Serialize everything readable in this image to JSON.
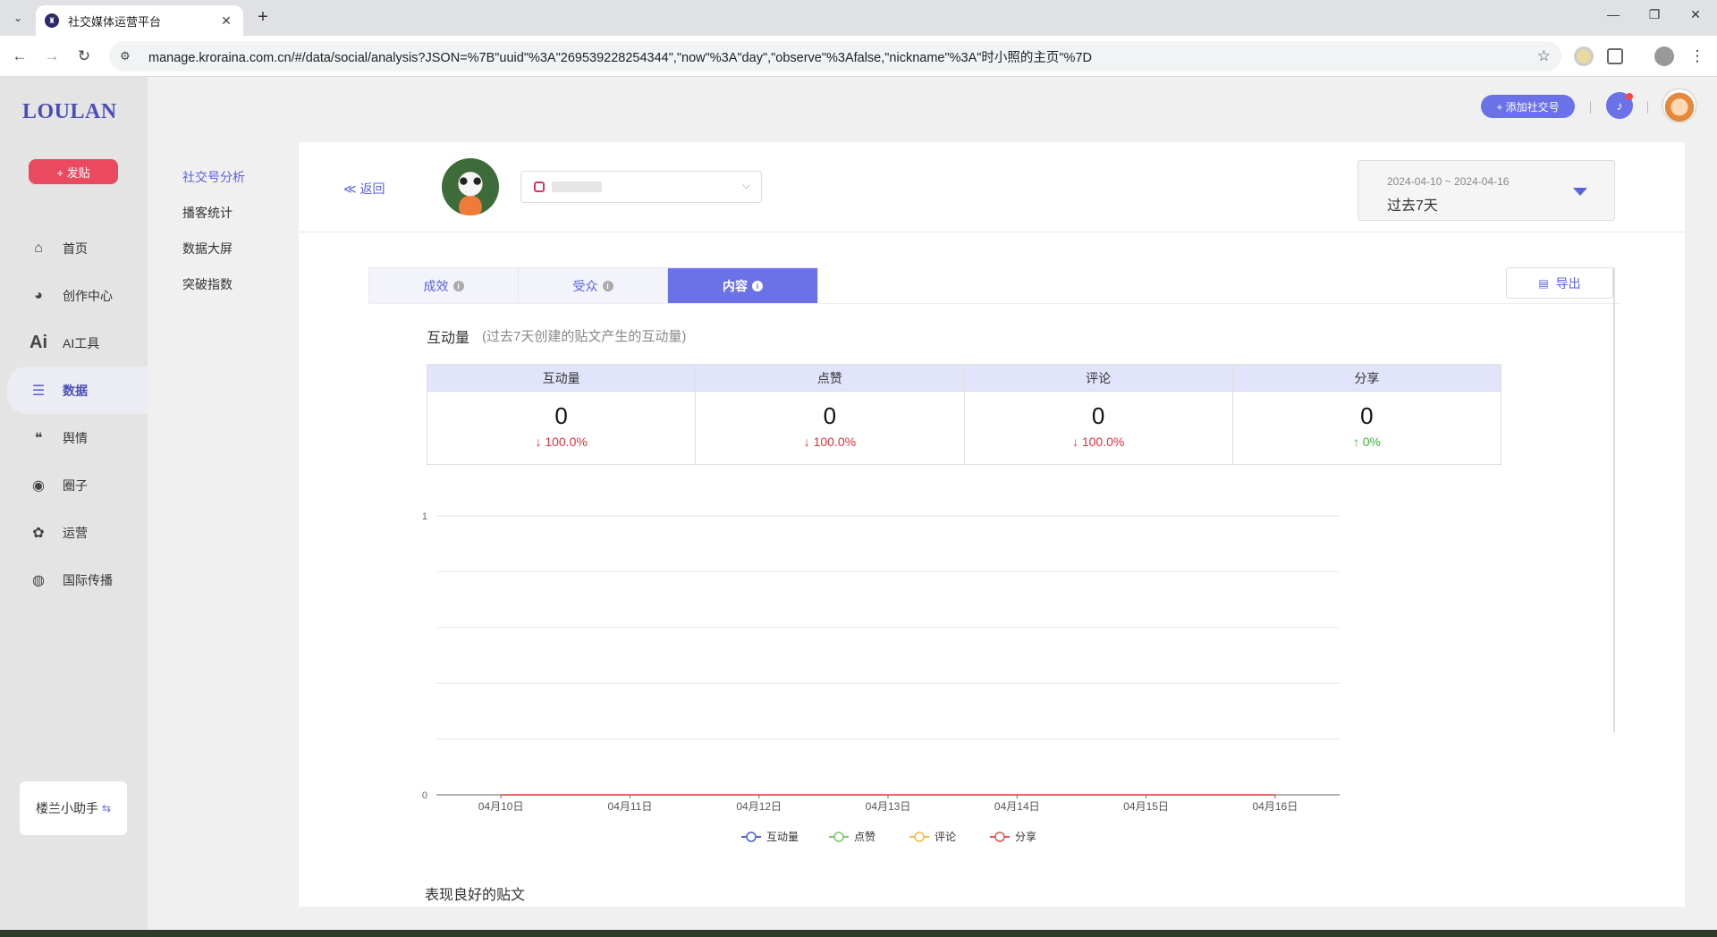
{
  "browser": {
    "tab_title": "社交媒体运营平台",
    "url": "manage.kroraina.com.cn/#/data/social/analysis?JSON=%7B\"uuid\"%3A\"269539228254344\",\"now\"%3A\"day\",\"observe\"%3Afalse,\"nickname\"%3A\"时小照的主页\"%7D"
  },
  "sidebar": {
    "logo": "LOULAN",
    "post_button": "+ 发贴",
    "items": [
      {
        "label": "首页",
        "icon": "home-icon"
      },
      {
        "label": "创作中心",
        "icon": "palette-icon"
      },
      {
        "label": "AI工具",
        "icon": "ai-icon"
      },
      {
        "label": "数据",
        "icon": "database-icon"
      },
      {
        "label": "舆情",
        "icon": "quote-icon"
      },
      {
        "label": "圈子",
        "icon": "compass-icon"
      },
      {
        "label": "运营",
        "icon": "settings-icon"
      },
      {
        "label": "国际传播",
        "icon": "globe-icon"
      }
    ],
    "assistant": "楼兰小助手"
  },
  "submenu": [
    "社交号分析",
    "播客统计",
    "数据大屏",
    "突破指数"
  ],
  "header": {
    "add_account": "+ 添加社交号"
  },
  "main": {
    "back": "≪ 返回",
    "date_range": "2024-04-10 ~ 2024-04-16",
    "date_label": "过去7天",
    "tabs": [
      "成效",
      "受众",
      "内容"
    ],
    "export": "导出",
    "section_title": "互动量",
    "section_subtitle": "(过去7天创建的贴文产生的互动量)",
    "stats": [
      {
        "label": "互动量",
        "value": "0",
        "change": "100.0%",
        "direction": "down"
      },
      {
        "label": "点赞",
        "value": "0",
        "change": "100.0%",
        "direction": "down"
      },
      {
        "label": "评论",
        "value": "0",
        "change": "100.0%",
        "direction": "down"
      },
      {
        "label": "分享",
        "value": "0",
        "change": "0%",
        "direction": "up"
      }
    ],
    "bottom_title": "表现良好的贴文"
  },
  "chart_data": {
    "type": "line",
    "categories": [
      "04月10日",
      "04月11日",
      "04月12日",
      "04月13日",
      "04月14日",
      "04月15日",
      "04月16日"
    ],
    "ylim": [
      0,
      1
    ],
    "yticks": [
      "0",
      "1"
    ],
    "series": [
      {
        "name": "互动量",
        "values": [
          0,
          0,
          0,
          0,
          0,
          0,
          0
        ],
        "color": "#4a5fd1"
      },
      {
        "name": "点赞",
        "values": [
          0,
          0,
          0,
          0,
          0,
          0,
          0
        ],
        "color": "#7cc56a"
      },
      {
        "name": "评论",
        "values": [
          0,
          0,
          0,
          0,
          0,
          0,
          0
        ],
        "color": "#f5b946"
      },
      {
        "name": "分享",
        "values": [
          0,
          0,
          0,
          0,
          0,
          0,
          0
        ],
        "color": "#e8505b"
      }
    ],
    "legend": "bottom"
  }
}
